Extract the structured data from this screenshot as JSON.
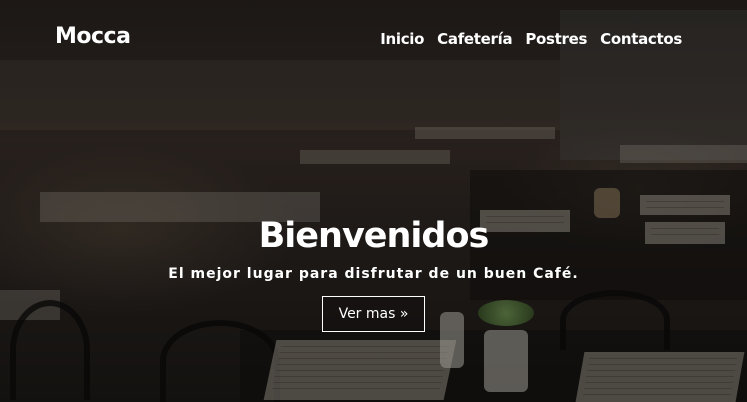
{
  "brand": {
    "name": "Mocca"
  },
  "nav": {
    "items": [
      {
        "label": "Inicio"
      },
      {
        "label": "Cafetería"
      },
      {
        "label": "Postres"
      },
      {
        "label": "Contactos"
      }
    ]
  },
  "hero": {
    "title": "Bienvenidos",
    "subtitle": "El mejor lugar para disfrutar de un buen Café.",
    "cta_label": "Ver mas »"
  },
  "colors": {
    "text": "#ffffff",
    "overlay": "#1a1715"
  }
}
